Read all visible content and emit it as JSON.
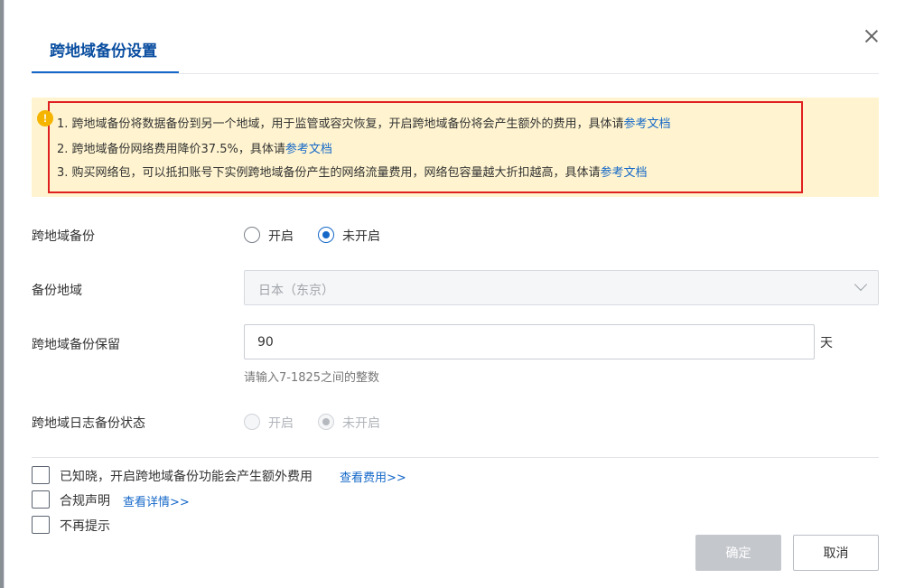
{
  "dialog": {
    "tab_title": "跨地域备份设置"
  },
  "notice": {
    "icon": "warning-icon",
    "lines": [
      {
        "text": "1. 跨地域备份将数据备份到另一个地域，用于监管或容灾恢复，开启跨地域备份将会产生额外的费用，具体请",
        "link": "参考文档"
      },
      {
        "text": "2. 跨地域备份网络费用降价37.5%，具体请",
        "link": "参考文档"
      },
      {
        "text": "3. 购买网络包，可以抵扣账号下实例跨地域备份产生的网络流量费用，网络包容量越大折扣越高，具体请",
        "link": "参考文档"
      }
    ]
  },
  "form": {
    "cross_region_backup": {
      "label": "跨地域备份",
      "options": [
        "开启",
        "未开启"
      ],
      "selected": "未开启"
    },
    "backup_region": {
      "label": "备份地域",
      "value": "日本（东京）"
    },
    "retention": {
      "label": "跨地域备份保留",
      "value": "90",
      "unit": "天",
      "hint": "请输入7-1825之间的整数"
    },
    "log_backup_status": {
      "label": "跨地域日志备份状态",
      "options": [
        "开启",
        "未开启"
      ],
      "selected": "未开启"
    }
  },
  "confirmations": [
    {
      "label": "已知晓，开启跨地域备份功能会产生额外费用",
      "link": "查看费用>>",
      "checked": false
    },
    {
      "label": "合规声明",
      "link": "查看详情>>",
      "checked": false
    },
    {
      "label": "不再提示",
      "checked": false
    }
  ],
  "buttons": {
    "ok": "确定",
    "cancel": "取消"
  },
  "colors": {
    "accent": "#1568c8",
    "notice_bg": "#fff4cf",
    "highlight_frame": "#e02020",
    "warning": "#f5b400"
  }
}
